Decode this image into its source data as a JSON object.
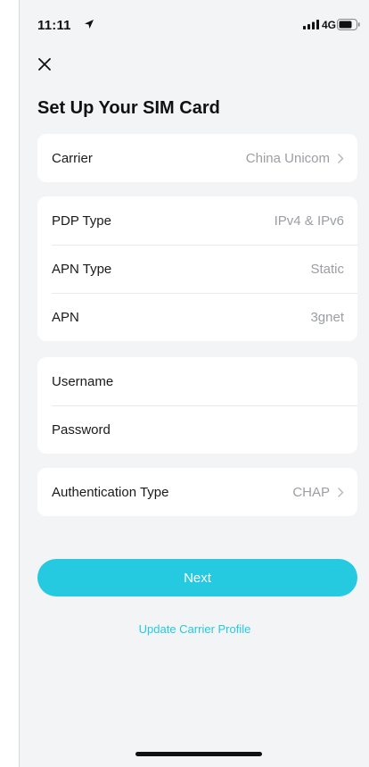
{
  "status_bar": {
    "time": "11:11",
    "network": "4G"
  },
  "icons": {
    "close": "close-icon",
    "chevron": "chevron-right-icon",
    "location": "location-arrow-icon",
    "signal": "signal-icon",
    "battery": "battery-icon"
  },
  "page": {
    "title": "Set Up Your SIM Card"
  },
  "carrier_card": {
    "label": "Carrier",
    "value": "China Unicom"
  },
  "apn_card": {
    "pdp_label": "PDP Type",
    "pdp_value": "IPv4 & IPv6",
    "apn_type_label": "APN Type",
    "apn_type_value": "Static",
    "apn_label": "APN",
    "apn_value": "3gnet"
  },
  "credentials_card": {
    "username_label": "Username",
    "password_label": "Password"
  },
  "auth_card": {
    "label": "Authentication Type",
    "value": "CHAP"
  },
  "actions": {
    "next_label": "Next",
    "update_label": "Update Carrier Profile"
  },
  "colors": {
    "accent": "#25c9e0",
    "background": "#f3f4f6",
    "card": "#ffffff",
    "muted": "#9b9ea3"
  }
}
